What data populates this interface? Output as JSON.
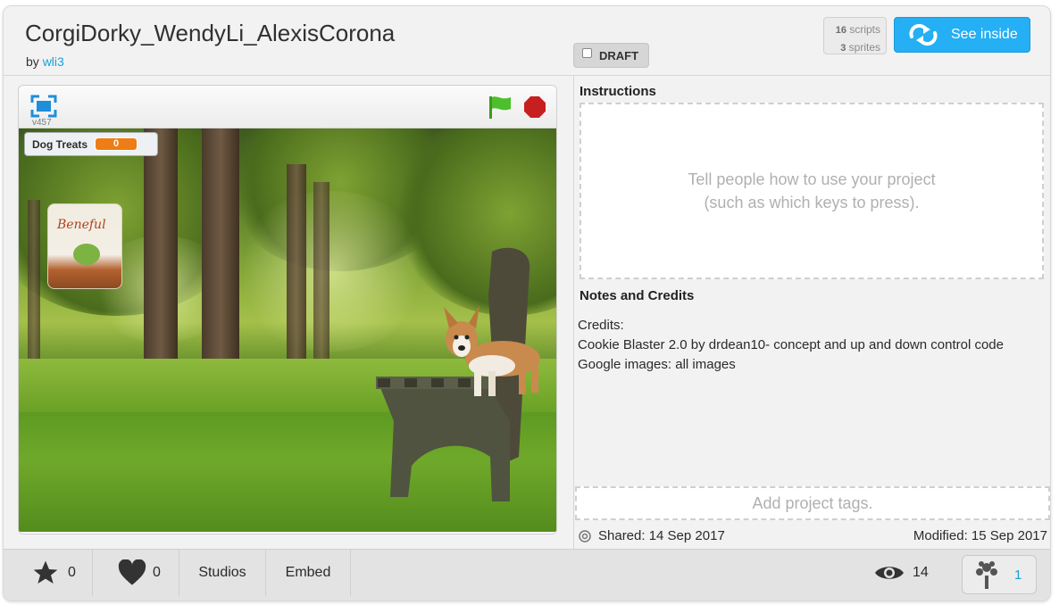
{
  "project": {
    "title": "CorgiDorky_WendyLi_AlexisCorona",
    "by_label": "by",
    "author": "wli3",
    "draft_label": "DRAFT",
    "scripts_count": "16",
    "scripts_label": "scripts",
    "sprites_count": "3",
    "sprites_label": "sprites",
    "see_inside_label": "See inside"
  },
  "player": {
    "version": "v457",
    "monitor_label": "Dog Treats",
    "monitor_value": "0",
    "treats_brand": "Beneful"
  },
  "instructions": {
    "title": "Instructions",
    "placeholder_line1": "Tell people how to use your project",
    "placeholder_line2": "(such as which keys to press)."
  },
  "notes": {
    "title": "Notes and Credits",
    "lines": [
      "Credits:",
      "Cookie Blaster 2.0 by drdean10- concept and up and down control code",
      "Google images: all images"
    ]
  },
  "tags": {
    "placeholder": "Add project tags."
  },
  "dates": {
    "shared": "Shared: 14 Sep 2017",
    "modified": "Modified: 15 Sep 2017"
  },
  "footer": {
    "favorites": "0",
    "loves": "0",
    "studios_label": "Studios",
    "embed_label": "Embed",
    "views": "14",
    "remixes": "1"
  },
  "colors": {
    "accent": "#25aff4",
    "link": "#1aa0d8",
    "monitor_value_bg": "#ee7d16",
    "stop": "#c71f1f",
    "flag": "#4cbf2b"
  }
}
